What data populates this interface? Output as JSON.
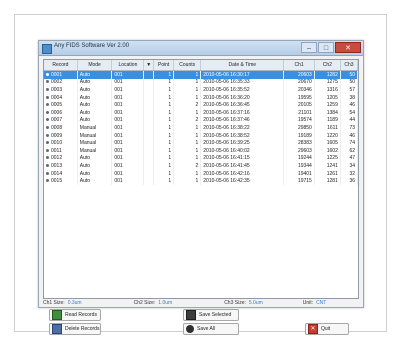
{
  "window": {
    "title": "Any FIDS Software Ver 2.00"
  },
  "columns": [
    "Record",
    "Mode",
    "Location",
    "▼",
    "Point",
    "Counts",
    "Date & Time",
    "Ch1",
    "Ch2",
    "Ch3"
  ],
  "rows": [
    {
      "record": "0001",
      "mode": "Auto",
      "location": "001",
      "point": "1",
      "counts": "1",
      "datetime": "2010-05-06 16:30:17",
      "ch1": "20603",
      "ch2": "1282",
      "ch3": "50"
    },
    {
      "record": "0002",
      "mode": "Auto",
      "location": "001",
      "point": "1",
      "counts": "1",
      "datetime": "2010-05-06 16:35:33",
      "ch1": "20670",
      "ch2": "1275",
      "ch3": "50"
    },
    {
      "record": "0003",
      "mode": "Auto",
      "location": "001",
      "point": "1",
      "counts": "1",
      "datetime": "2010-05-06 16:35:52",
      "ch1": "20346",
      "ch2": "1316",
      "ch3": "57"
    },
    {
      "record": "0004",
      "mode": "Auto",
      "location": "001",
      "point": "1",
      "counts": "1",
      "datetime": "2010-05-06 16:36:20",
      "ch1": "19595",
      "ch2": "1205",
      "ch3": "38"
    },
    {
      "record": "0005",
      "mode": "Auto",
      "location": "001",
      "point": "1",
      "counts": "2",
      "datetime": "2010-05-06 16:36:45",
      "ch1": "20105",
      "ch2": "1259",
      "ch3": "46"
    },
    {
      "record": "0006",
      "mode": "Auto",
      "location": "001",
      "point": "1",
      "counts": "1",
      "datetime": "2010-05-06 16:37:16",
      "ch1": "21101",
      "ch2": "1384",
      "ch3": "54"
    },
    {
      "record": "0007",
      "mode": "Auto",
      "location": "001",
      "point": "1",
      "counts": "2",
      "datetime": "2010-05-06 16:37:46",
      "ch1": "19574",
      "ch2": "1189",
      "ch3": "44"
    },
    {
      "record": "0008",
      "mode": "Manual",
      "location": "001",
      "point": "1",
      "counts": "1",
      "datetime": "2010-05-06 16:38:22",
      "ch1": "29850",
      "ch2": "1611",
      "ch3": "73"
    },
    {
      "record": "0009",
      "mode": "Manual",
      "location": "001",
      "point": "1",
      "counts": "1",
      "datetime": "2010-05-06 16:38:52",
      "ch1": "19189",
      "ch2": "1220",
      "ch3": "46"
    },
    {
      "record": "0010",
      "mode": "Manual",
      "location": "001",
      "point": "1",
      "counts": "1",
      "datetime": "2010-05-06 16:39:25",
      "ch1": "28383",
      "ch2": "1605",
      "ch3": "74"
    },
    {
      "record": "0011",
      "mode": "Manual",
      "location": "001",
      "point": "1",
      "counts": "1",
      "datetime": "2010-05-06 16:40:02",
      "ch1": "29603",
      "ch2": "1602",
      "ch3": "62"
    },
    {
      "record": "0012",
      "mode": "Auto",
      "location": "001",
      "point": "1",
      "counts": "1",
      "datetime": "2010-05-06 16:41:15",
      "ch1": "19244",
      "ch2": "1225",
      "ch3": "47"
    },
    {
      "record": "0013",
      "mode": "Auto",
      "location": "001",
      "point": "1",
      "counts": "2",
      "datetime": "2010-05-06 16:41:45",
      "ch1": "19344",
      "ch2": "1241",
      "ch3": "34"
    },
    {
      "record": "0014",
      "mode": "Auto",
      "location": "001",
      "point": "1",
      "counts": "1",
      "datetime": "2010-05-06 16:42:16",
      "ch1": "19401",
      "ch2": "1261",
      "ch3": "32"
    },
    {
      "record": "0015",
      "mode": "Auto",
      "location": "001",
      "point": "1",
      "counts": "1",
      "datetime": "2010-05-06 16:42:35",
      "ch1": "19715",
      "ch2": "1281",
      "ch3": "36"
    }
  ],
  "status": {
    "ch1_label": "Ch1 Size:",
    "ch1_value": "0.3um",
    "ch2_label": "Ch2 Size:",
    "ch2_value": "1.0um",
    "ch3_label": "Ch3 Size:",
    "ch3_value": "5.0um",
    "unit_label": "Unit:",
    "unit_value": "CNT"
  },
  "buttons": {
    "read": "Read Records",
    "delete": "Delete Records",
    "save_selected": "Save Selected",
    "save_all": "Save All",
    "quit": "Quit"
  },
  "colors": {
    "selection": "#3b8fe0",
    "close": "#c64c3b"
  }
}
